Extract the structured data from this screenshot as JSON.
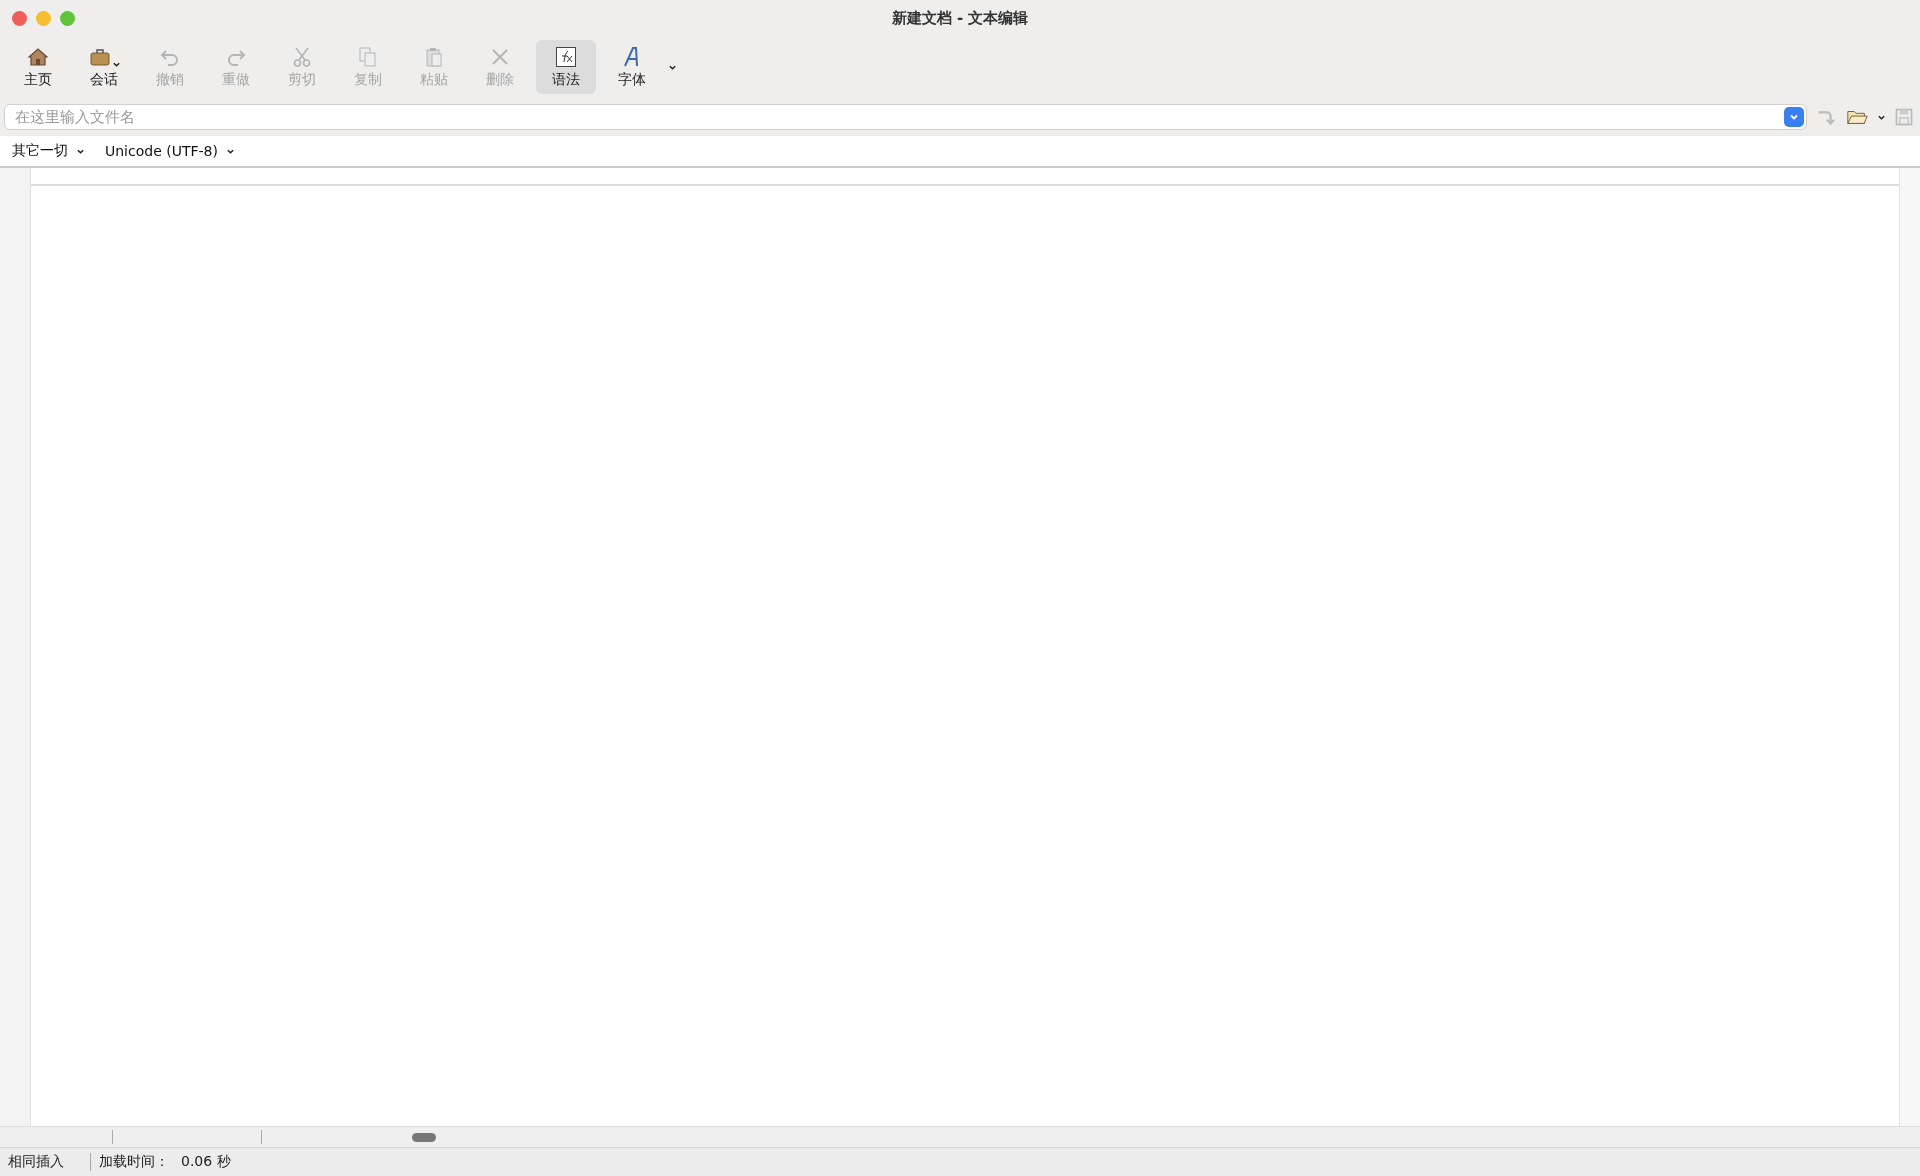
{
  "window": {
    "title": "新建文档 - 文本编辑"
  },
  "toolbar": [
    {
      "label": "主页",
      "disabled": false,
      "selected": false
    },
    {
      "label": "会话",
      "disabled": false,
      "selected": false,
      "menu": true
    },
    {
      "label": "撤销",
      "disabled": true,
      "selected": false
    },
    {
      "label": "重做",
      "disabled": true,
      "selected": false
    },
    {
      "label": "剪切",
      "disabled": true,
      "selected": false
    },
    {
      "label": "复制",
      "disabled": true,
      "selected": false
    },
    {
      "label": "粘贴",
      "disabled": true,
      "selected": false
    },
    {
      "label": "删除",
      "disabled": true,
      "selected": false
    },
    {
      "label": "语法",
      "disabled": false,
      "selected": true
    },
    {
      "label": "字体",
      "disabled": false,
      "selected": false
    }
  ],
  "filename": {
    "placeholder": "在这里输入文件名"
  },
  "options": [
    {
      "label": "其它一切"
    },
    {
      "label": "Unicode (UTF-8)"
    }
  ],
  "status_bar": {
    "mode": "相同插入",
    "load_label": "加载时间：",
    "load_value": "0.06 秒"
  }
}
